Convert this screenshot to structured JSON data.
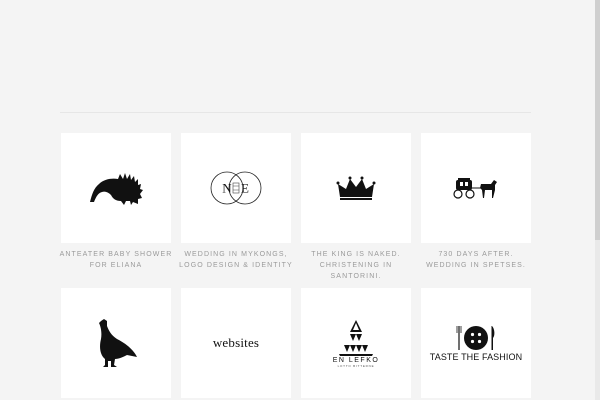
{
  "portfolio": {
    "items": [
      {
        "caption": "ANTEATER BABY SHOWER FOR ELIANA",
        "icon": "anteater-icon"
      },
      {
        "caption": "WEDDING IN MYKONGS, LOGO DESIGN & IDENTITY",
        "icon": "ne-monogram-icon",
        "logo_left": "N",
        "logo_right": "E"
      },
      {
        "caption": "THE KING IS NAKED. CHRISTENING IN SANTORINI.",
        "icon": "crown-icon"
      },
      {
        "caption": "730 DAYS AFTER. WEDDING IN SPETSES.",
        "icon": "horse-carriage-icon"
      },
      {
        "caption": "",
        "icon": "partridge-icon"
      },
      {
        "caption": "",
        "icon": "websites-wordmark",
        "logo_text": "websites"
      },
      {
        "caption": "",
        "icon": "en-lefko-logo",
        "logo_text": "EN LEFKO",
        "logo_subtext": "LOTTO BITTERNE"
      },
      {
        "caption": "",
        "icon": "taste-the-fashion-logo",
        "logo_text": "TASTE THE FASHION"
      }
    ]
  },
  "colors": {
    "background": "#f4f4f4",
    "tile": "#ffffff",
    "caption": "#9a9a9a",
    "logo": "#111111"
  }
}
